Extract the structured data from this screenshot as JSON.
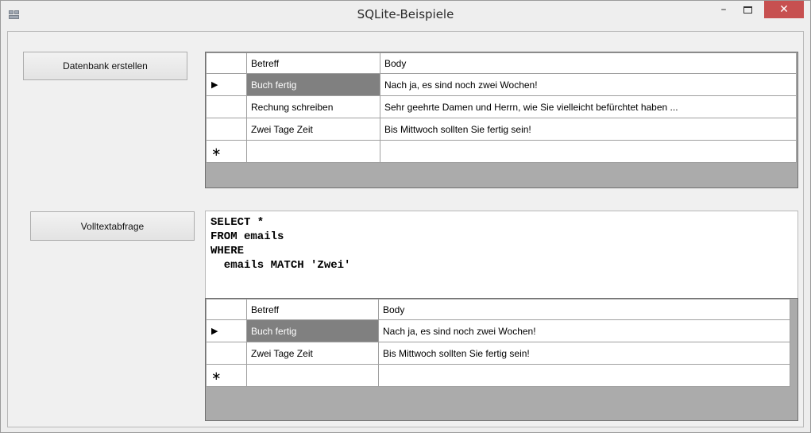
{
  "window": {
    "title": "SQLite-Beispiele",
    "minimize_glyph": "–",
    "close_glyph": "✕"
  },
  "buttons": {
    "create_db": "Datenbank erstellen",
    "fulltext_query": "Volltextabfrage"
  },
  "grid_all": {
    "columns": [
      "Betreff",
      "Body"
    ],
    "current_row_glyph": "▶",
    "new_row_glyph": "∗",
    "rows": [
      {
        "betreff": "Buch fertig",
        "body": "Nach ja, es sind noch zwei Wochen!"
      },
      {
        "betreff": "Rechung schreiben",
        "body": "Sehr geehrte Damen und Herrn, wie Sie vielleicht befürchtet haben ..."
      },
      {
        "betreff": "Zwei Tage Zeit",
        "body": "Bis Mittwoch sollten Sie fertig sein!"
      }
    ]
  },
  "sql": {
    "text": "SELECT *\nFROM emails\nWHERE\n  emails MATCH 'Zwei'"
  },
  "grid_result": {
    "columns": [
      "Betreff",
      "Body"
    ],
    "current_row_glyph": "▶",
    "new_row_glyph": "∗",
    "rows": [
      {
        "betreff": "Buch fertig",
        "body": "Nach ja, es sind noch zwei Wochen!"
      },
      {
        "betreff": "Zwei Tage Zeit",
        "body": "Bis Mittwoch sollten Sie fertig sein!"
      }
    ]
  },
  "colors": {
    "selected_cell": "#808080",
    "grid_background": "#ababab",
    "close_button": "#c75050"
  }
}
